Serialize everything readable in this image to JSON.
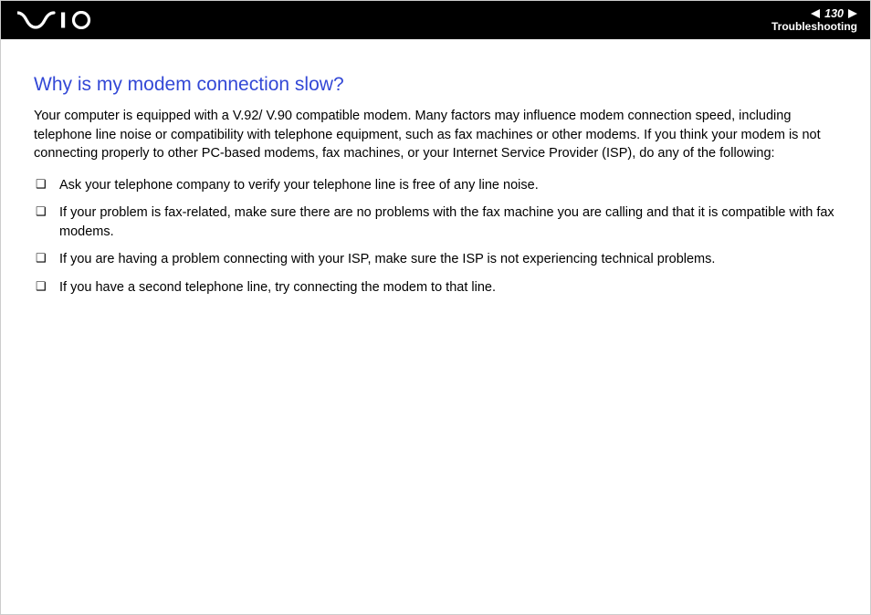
{
  "header": {
    "page_number": "130",
    "section": "Troubleshooting"
  },
  "main": {
    "heading": "Why is my modem connection slow?",
    "intro": "Your computer is equipped with a V.92/ V.90 compatible modem. Many factors may influence modem connection speed, including telephone line noise or compatibility with telephone equipment, such as fax machines or other modems. If you think your modem is not connecting properly to other PC-based modems, fax machines, or your Internet Service Provider (ISP), do any of the following:",
    "bullets": [
      "Ask your telephone company to verify your telephone line is free of any line noise.",
      "If your problem is fax-related, make sure there are no problems with the fax machine you are calling and that it is compatible with fax modems.",
      "If you are having a problem connecting with your ISP, make sure the ISP is not experiencing technical problems.",
      "If you have a second telephone line, try connecting the modem to that line."
    ]
  }
}
